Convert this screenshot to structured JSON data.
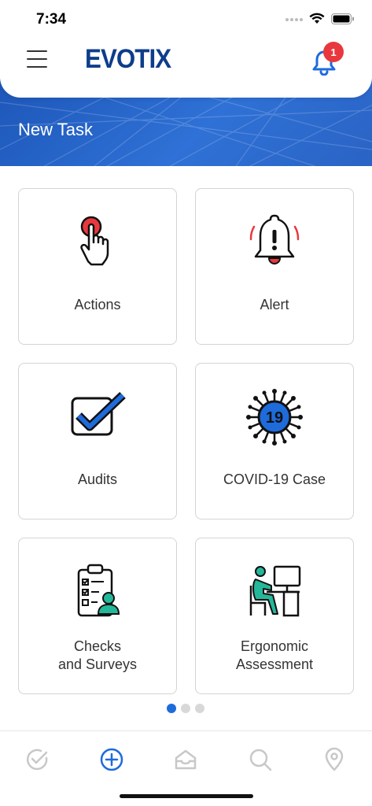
{
  "status_bar": {
    "time": "7:34"
  },
  "header": {
    "logo": "EVOTIX",
    "notifications_count": "1"
  },
  "banner": {
    "title": "New Task"
  },
  "tasks": [
    {
      "label": "Actions",
      "icon": "hand-press-button-icon"
    },
    {
      "label": "Alert",
      "icon": "alarm-bell-icon"
    },
    {
      "label": "Audits",
      "icon": "checkbox-icon"
    },
    {
      "label": "COVID-19 Case",
      "icon": "virus-icon"
    },
    {
      "label": "Checks\nand Surveys",
      "icon": "clipboard-checklist-icon"
    },
    {
      "label": "Ergonomic\nAssessment",
      "icon": "person-at-desk-icon"
    }
  ],
  "pagination": {
    "current": 1,
    "total": 3
  },
  "tabbar": {
    "items": [
      {
        "icon": "check-circle-icon",
        "active": false
      },
      {
        "icon": "add-circle-icon",
        "active": true
      },
      {
        "icon": "inbox-icon",
        "active": false
      },
      {
        "icon": "search-icon",
        "active": false
      },
      {
        "icon": "location-pin-icon",
        "active": false
      }
    ]
  },
  "colors": {
    "accent": "#1e6bdc",
    "banner": "#2a63c4",
    "logo": "#0d3d8c",
    "badge": "#e8383d",
    "icon_red": "#e8383d",
    "icon_teal": "#24b89a"
  }
}
